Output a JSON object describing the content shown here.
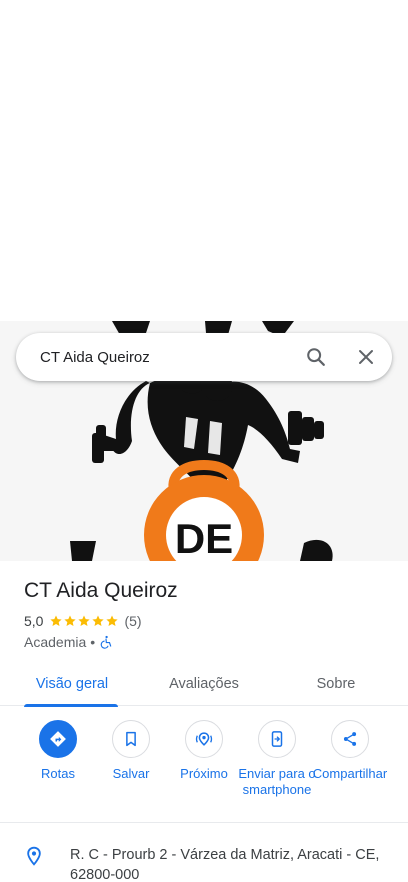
{
  "search": {
    "query": "CT Aida Queiroz"
  },
  "place": {
    "name": "CT Aida Queiroz",
    "rating": "5,0",
    "stars": 5,
    "review_count": "(5)",
    "category": "Academia",
    "separator": "•"
  },
  "tabs": [
    {
      "label": "Visão geral"
    },
    {
      "label": "Avaliações"
    },
    {
      "label": "Sobre"
    }
  ],
  "actions": [
    {
      "label": "Rotas",
      "icon": "directions-icon"
    },
    {
      "label": "Salvar",
      "icon": "bookmark-icon"
    },
    {
      "label": "Próximo",
      "icon": "nearby-icon"
    },
    {
      "label": "Enviar para o smartphone",
      "icon": "send-to-phone-icon"
    },
    {
      "label": "Compartilhar",
      "icon": "share-icon"
    }
  ],
  "address": {
    "text": "R. C - Prourb 2 - Várzea da Matriz, Aracati - CE, 62800-000"
  },
  "colors": {
    "accent": "#1a73e8",
    "star": "#fbbc04",
    "logo_orange": "#f07a1a"
  },
  "hero": {
    "logo_text": "DE"
  }
}
